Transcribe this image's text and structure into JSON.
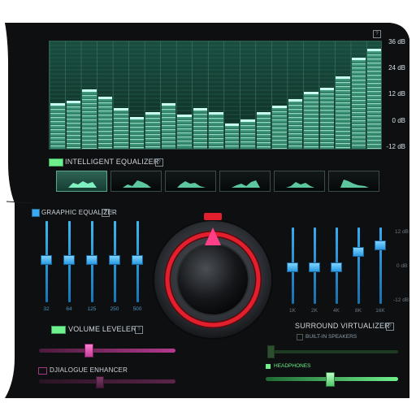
{
  "equalizer": {
    "db_labels": [
      "36 dB",
      "24 dB",
      "12 dB",
      "0 dB",
      "-12 dB"
    ],
    "band_levels_db": [
      8,
      9,
      14,
      11,
      6,
      2,
      4,
      8,
      3,
      6,
      4,
      -1,
      1,
      4,
      7,
      10,
      13,
      15,
      20,
      28,
      32
    ],
    "intelligent_label": "INTELLIGENT EQUALIZER",
    "presets": [
      "preset-1",
      "preset-2",
      "preset-3",
      "preset-4",
      "preset-5",
      "preset-6"
    ],
    "active_preset": 0
  },
  "graphic_eq": {
    "label": "GRAAPHIC EQUALIZER",
    "bands": [
      {
        "freq": "32",
        "level": 0.52
      },
      {
        "freq": "64",
        "level": 0.52
      },
      {
        "freq": "125",
        "level": 0.52
      },
      {
        "freq": "250",
        "level": 0.52
      },
      {
        "freq": "500",
        "level": 0.52
      }
    ]
  },
  "surround_eq": {
    "db_labels": [
      "12 dB",
      "0 dB",
      "-12 dB"
    ],
    "bands": [
      {
        "freq": "1K",
        "level": 0.48
      },
      {
        "freq": "2K",
        "level": 0.48
      },
      {
        "freq": "4K",
        "level": 0.48
      },
      {
        "freq": "8K",
        "level": 0.68
      },
      {
        "freq": "16K",
        "level": 0.77
      }
    ]
  },
  "volume_leveler": {
    "label": "VOLUME LEVELER",
    "value": 0.36
  },
  "dialogue_enhancer": {
    "label": "DJIALOGUE ENHANCER",
    "value": 0.44
  },
  "surround": {
    "label": "SURROUND VIRTUALIZER",
    "built_in_speakers": "BUILT-IN SPEAKERS",
    "built_in_value": 0.02,
    "headphones": "HEADPHONES",
    "headphones_value": 0.48
  },
  "colors": {
    "accent_green": "#6ef08c",
    "accent_pink": "#d04aa4",
    "accent_red": "#e2202d",
    "accent_blue": "#3aaaf0"
  },
  "help_glyph": "?"
}
